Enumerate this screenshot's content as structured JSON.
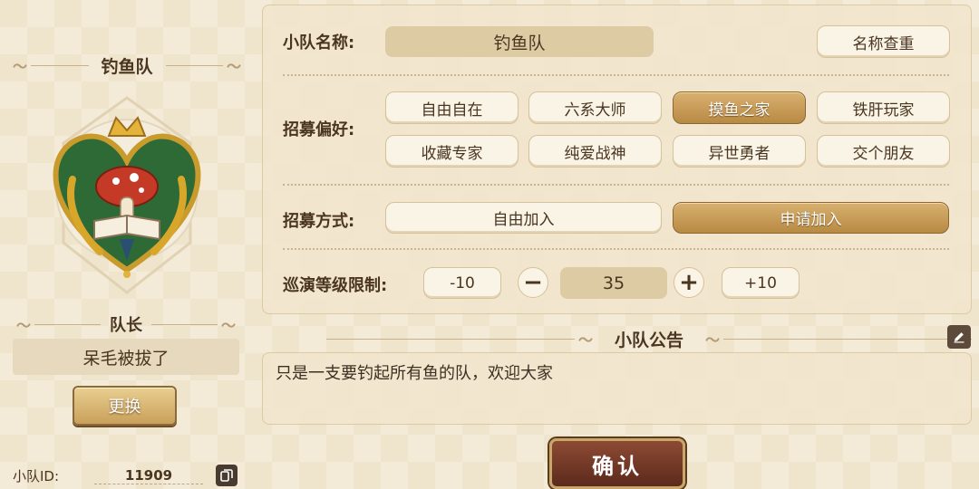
{
  "team": {
    "name": "钓鱼队",
    "emblem_icon": "mushroom-book-heart-emblem",
    "captain_title": "队长",
    "captain_name": "呆毛被拔了",
    "change_label": "更换",
    "id_label": "小队ID:",
    "id_value": "11909"
  },
  "settings": {
    "name_label": "小队名称:",
    "name_value": "钓鱼队",
    "check_name_label": "名称查重",
    "preference_label": "招募偏好:",
    "preferences": [
      {
        "label": "自由自在",
        "selected": false
      },
      {
        "label": "六系大师",
        "selected": false
      },
      {
        "label": "摸鱼之家",
        "selected": true
      },
      {
        "label": "铁肝玩家",
        "selected": false
      },
      {
        "label": "收藏专家",
        "selected": false
      },
      {
        "label": "纯爱战神",
        "selected": false
      },
      {
        "label": "异世勇者",
        "selected": false
      },
      {
        "label": "交个朋友",
        "selected": false
      }
    ],
    "method_label": "招募方式:",
    "methods": [
      {
        "label": "自由加入",
        "selected": false
      },
      {
        "label": "申请加入",
        "selected": true
      }
    ],
    "level_label": "巡演等级限制:",
    "minus10_label": "-10",
    "minus_label": "−",
    "level_value": "35",
    "plus_label": "+",
    "plus10_label": "+10"
  },
  "notice": {
    "title": "小队公告",
    "text": "只是一支要钓起所有鱼的队，欢迎大家"
  },
  "confirm_label": "确认",
  "colors": {
    "accent": "#b88a44",
    "confirm": "#6e3424",
    "background": "#efe4cc"
  }
}
